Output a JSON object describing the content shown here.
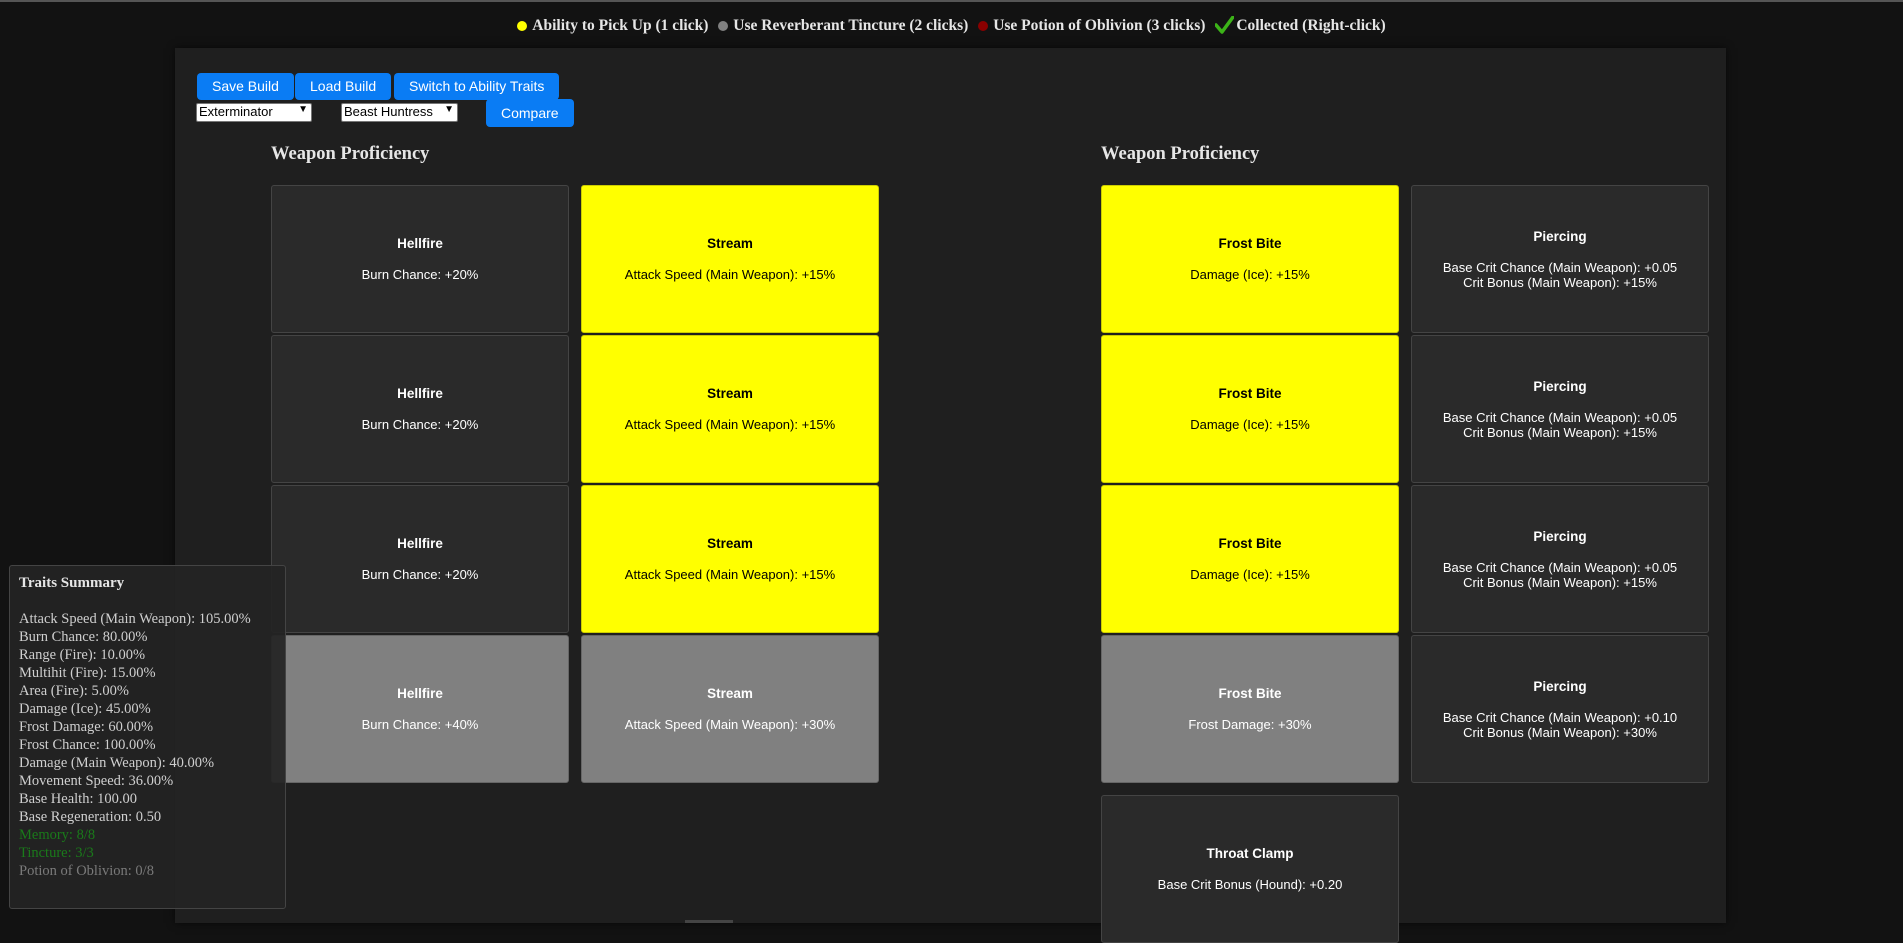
{
  "legend": {
    "items": [
      {
        "label": "Ability to Pick Up (1 click)",
        "color": "#ffff00",
        "icon": "yellow-dot-icon"
      },
      {
        "label": "Use Reverberant Tincture (2 clicks)",
        "color": "#808080",
        "icon": "gray-dot-icon"
      },
      {
        "label": "Use Potion of Oblivion (3 clicks)",
        "color": "#8b0000",
        "icon": "red-dot-icon"
      },
      {
        "label": "Collected (Right-click)",
        "color": "#3cb318",
        "icon": "checkmark-icon"
      }
    ]
  },
  "toolbar": {
    "save_label": "Save Build",
    "load_label": "Load Build",
    "switch_label": "Switch to Ability Traits",
    "compare_label": "Compare",
    "class_left": "Exterminator",
    "class_right": "Beast Huntress"
  },
  "left": {
    "title": "Weapon Proficiency",
    "cards": [
      {
        "name": "Hellfire",
        "desc": [
          "Burn Chance: +20%"
        ],
        "state": "dark"
      },
      {
        "name": "Stream",
        "desc": [
          "Attack Speed (Main Weapon): +15%"
        ],
        "state": "yellow"
      },
      {
        "name": "Hellfire",
        "desc": [
          "Burn Chance: +20%"
        ],
        "state": "dark"
      },
      {
        "name": "Stream",
        "desc": [
          "Attack Speed (Main Weapon): +15%"
        ],
        "state": "yellow"
      },
      {
        "name": "Hellfire",
        "desc": [
          "Burn Chance: +20%"
        ],
        "state": "dark"
      },
      {
        "name": "Stream",
        "desc": [
          "Attack Speed (Main Weapon): +15%"
        ],
        "state": "yellow"
      },
      {
        "name": "Hellfire",
        "desc": [
          "Burn Chance: +40%"
        ],
        "state": "gray"
      },
      {
        "name": "Stream",
        "desc": [
          "Attack Speed (Main Weapon): +30%"
        ],
        "state": "gray"
      }
    ]
  },
  "right": {
    "title": "Weapon Proficiency",
    "cards": [
      {
        "name": "Frost Bite",
        "desc": [
          "Damage (Ice): +15%"
        ],
        "state": "yellow"
      },
      {
        "name": "Piercing",
        "desc": [
          "Base Crit Chance (Main Weapon): +0.05",
          "Crit Bonus (Main Weapon): +15%"
        ],
        "state": "dark"
      },
      {
        "name": "Frost Bite",
        "desc": [
          "Damage (Ice): +15%"
        ],
        "state": "yellow"
      },
      {
        "name": "Piercing",
        "desc": [
          "Base Crit Chance (Main Weapon): +0.05",
          "Crit Bonus (Main Weapon): +15%"
        ],
        "state": "dark"
      },
      {
        "name": "Frost Bite",
        "desc": [
          "Damage (Ice): +15%"
        ],
        "state": "yellow"
      },
      {
        "name": "Piercing",
        "desc": [
          "Base Crit Chance (Main Weapon): +0.05",
          "Crit Bonus (Main Weapon): +15%"
        ],
        "state": "dark"
      },
      {
        "name": "Frost Bite",
        "desc": [
          "Frost Damage: +30%"
        ],
        "state": "gray"
      },
      {
        "name": "Piercing",
        "desc": [
          "Base Crit Chance (Main Weapon): +0.10",
          "Crit Bonus (Main Weapon): +30%"
        ],
        "state": "dark"
      },
      {
        "name": "Throat Clamp",
        "desc": [
          "Base Crit Bonus (Hound): +0.20"
        ],
        "state": "dark"
      }
    ]
  },
  "summary": {
    "title": "Traits Summary",
    "lines": [
      {
        "text": "Attack Speed (Main Weapon): 105.00%",
        "style": "normal"
      },
      {
        "text": "Burn Chance: 80.00%",
        "style": "normal"
      },
      {
        "text": "Range (Fire): 10.00%",
        "style": "normal"
      },
      {
        "text": "Multihit (Fire): 15.00%",
        "style": "normal"
      },
      {
        "text": "Area (Fire): 5.00%",
        "style": "normal"
      },
      {
        "text": "Damage (Ice): 45.00%",
        "style": "normal"
      },
      {
        "text": "Frost Damage: 60.00%",
        "style": "normal"
      },
      {
        "text": "Frost Chance: 100.00%",
        "style": "normal"
      },
      {
        "text": "Damage (Main Weapon): 40.00%",
        "style": "normal"
      },
      {
        "text": "Movement Speed: 36.00%",
        "style": "normal"
      },
      {
        "text": "Base Health: 100.00",
        "style": "normal"
      },
      {
        "text": "Base Regeneration: 0.50",
        "style": "normal"
      },
      {
        "text": "Memory: 8/8",
        "style": "green"
      },
      {
        "text": "Tincture: 3/3",
        "style": "green"
      },
      {
        "text": "Potion of Oblivion: 0/8",
        "style": "muted"
      }
    ]
  }
}
